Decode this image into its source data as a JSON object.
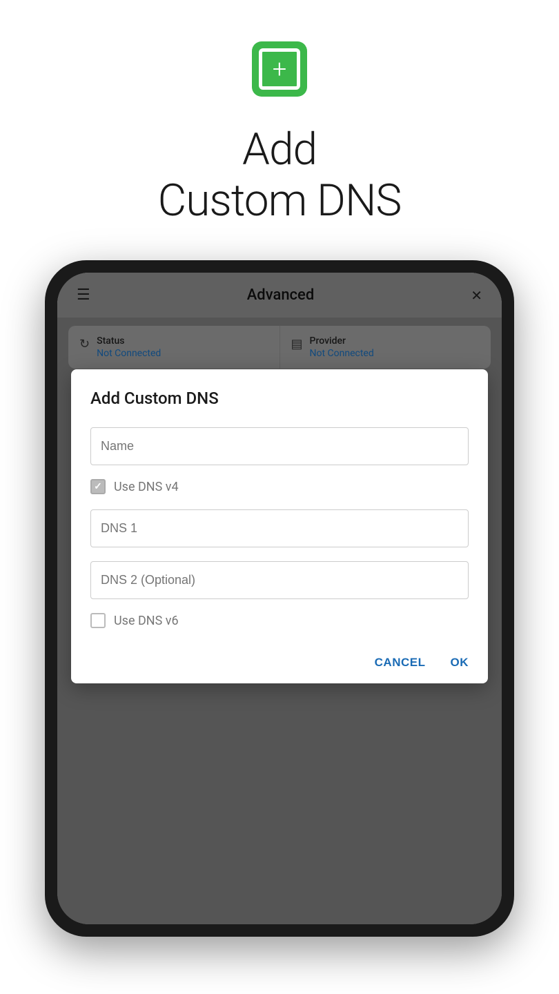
{
  "header": {
    "icon_label": "add-to-playlist-icon",
    "title_line1": "Add",
    "title_line2": "Custom DNS"
  },
  "phone": {
    "screen": {
      "navbar": {
        "title": "Advanced",
        "hamburger_label": "☰",
        "share_label": "⬡"
      },
      "status_bar": {
        "status": {
          "icon": "↻",
          "label": "Status",
          "value": "Not Connected"
        },
        "provider": {
          "icon": "▤",
          "label": "Provider",
          "value": "Not Connected"
        }
      },
      "dialog": {
        "title": "Add Custom DNS",
        "name_placeholder": "Name",
        "dns_v4_label": "Use DNS v4",
        "dns_v4_checked": true,
        "dns1_placeholder": "DNS 1",
        "dns2_placeholder": "DNS 2 (Optional)",
        "dns_v6_label": "Use DNS v6",
        "dns_v6_checked": false,
        "cancel_label": "CANCEL",
        "ok_label": "OK"
      }
    }
  }
}
